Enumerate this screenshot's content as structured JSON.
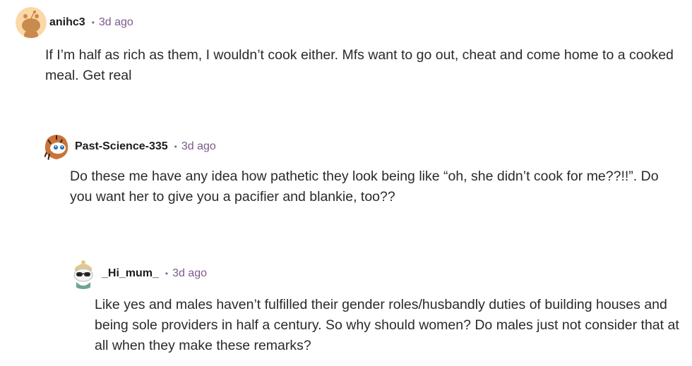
{
  "comments": [
    {
      "username": "anihc3",
      "separator": "•",
      "time": "3d ago",
      "text": "If I’m half as rich as them, I wouldn’t cook either. Mfs want to go out, cheat and come home to a cooked meal. Get real",
      "avatar_icon": "snoo-avatar-icon",
      "avatar_color": "#f4c27a"
    },
    {
      "username": "Past-Science-335",
      "separator": "•",
      "time": "3d ago",
      "text": "Do these me have any idea how pathetic they look being like “oh, she didn’t cook for me??!!”. Do you want her to give you a pacifier and blankie, too??",
      "avatar_icon": "tiger-snoo-avatar-icon",
      "avatar_color": "#c9743a"
    },
    {
      "username": "_Hi_mum_",
      "separator": "•",
      "time": "3d ago",
      "text": "Like yes and males haven’t fulfilled their gender roles/husbandly duties of building houses and being sole providers in half a century. So why should women? Do males just not consider that at all when they make these remarks?",
      "avatar_icon": "sunglasses-snoo-avatar-icon",
      "avatar_color": "#e9e2cf"
    }
  ]
}
